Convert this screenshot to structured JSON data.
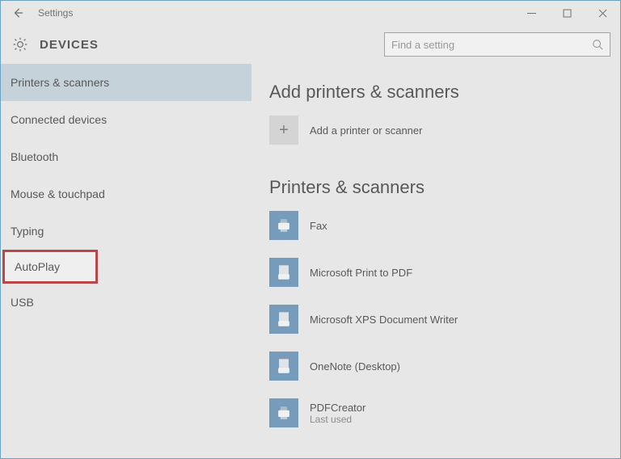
{
  "window": {
    "title": "Settings"
  },
  "header": {
    "page_title": "DEVICES",
    "search_placeholder": "Find a setting"
  },
  "sidebar": {
    "items": [
      {
        "label": "Printers & scanners",
        "state": "selected"
      },
      {
        "label": "Connected devices",
        "state": ""
      },
      {
        "label": "Bluetooth",
        "state": ""
      },
      {
        "label": "Mouse & touchpad",
        "state": ""
      },
      {
        "label": "Typing",
        "state": ""
      },
      {
        "label": "AutoPlay",
        "state": "highlighted"
      },
      {
        "label": "USB",
        "state": ""
      }
    ]
  },
  "content": {
    "section_add_title": "Add printers & scanners",
    "add_label": "Add a printer or scanner",
    "plus_glyph": "+",
    "section_list_title": "Printers & scanners",
    "devices": [
      {
        "name": "Fax",
        "sub": "",
        "icon": "printer"
      },
      {
        "name": "Microsoft Print to PDF",
        "sub": "",
        "icon": "file-printer"
      },
      {
        "name": "Microsoft XPS Document Writer",
        "sub": "",
        "icon": "file-printer"
      },
      {
        "name": "OneNote (Desktop)",
        "sub": "",
        "icon": "file-printer"
      },
      {
        "name": "PDFCreator",
        "sub": "Last used",
        "icon": "printer"
      }
    ]
  }
}
